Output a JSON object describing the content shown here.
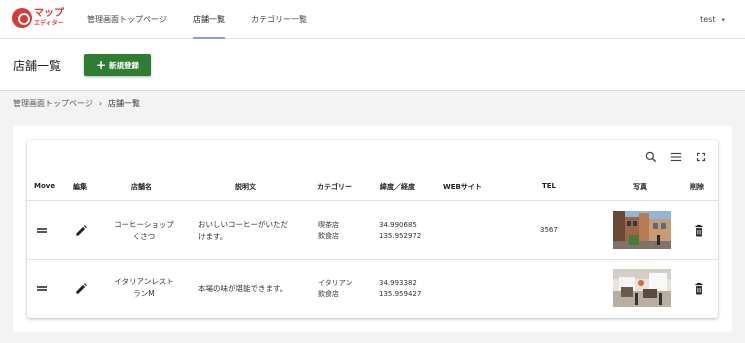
{
  "header": {
    "logo_main": "マップ",
    "logo_sub": "エディター",
    "nav": [
      "管理画面トップページ",
      "店舗一覧",
      "カテゴリー一覧"
    ],
    "user": "test"
  },
  "titlebar": {
    "title": "店舗一覧",
    "new_button": "新規登録"
  },
  "breadcrumb": {
    "root": "管理画面トップページ",
    "separator": "›",
    "current": "店舗一覧"
  },
  "table": {
    "toolbar_icons": [
      "search-icon",
      "columns-icon",
      "fullscreen-icon"
    ],
    "columns": [
      "Move",
      "編集",
      "店舗名",
      "説明文",
      "カテゴリー",
      "緯度／経度",
      "WEBサイト",
      "TEL",
      "写真",
      "削除"
    ],
    "rows": [
      {
        "name_line1": "コーヒーショップ",
        "name_line2": "くさつ",
        "desc_line1": "おいしいコーヒーがいただ",
        "desc_line2": "けます。",
        "cat_line1": "喫茶店",
        "cat_line2": "飲食店",
        "lat": "34.990685",
        "lng": "135.952972",
        "website": "",
        "tel": "3567",
        "photo": "street-cafe-photo"
      },
      {
        "name_line1": "イタリアンレスト",
        "name_line2": "ランM",
        "desc_line1": "本場の味が堪能できます。",
        "desc_line2": "",
        "cat_line1": "イタリアン",
        "cat_line2": "飲食店",
        "lat": "34.993382",
        "lng": "135.959427",
        "website": "",
        "tel": "",
        "photo": "restaurant-interior-photo"
      }
    ]
  },
  "colors": {
    "brand": "#d83a3a",
    "primary_button": "#2e7d32",
    "background": "#f3f3f3",
    "active_tab_underline": "#8aa0c8"
  }
}
